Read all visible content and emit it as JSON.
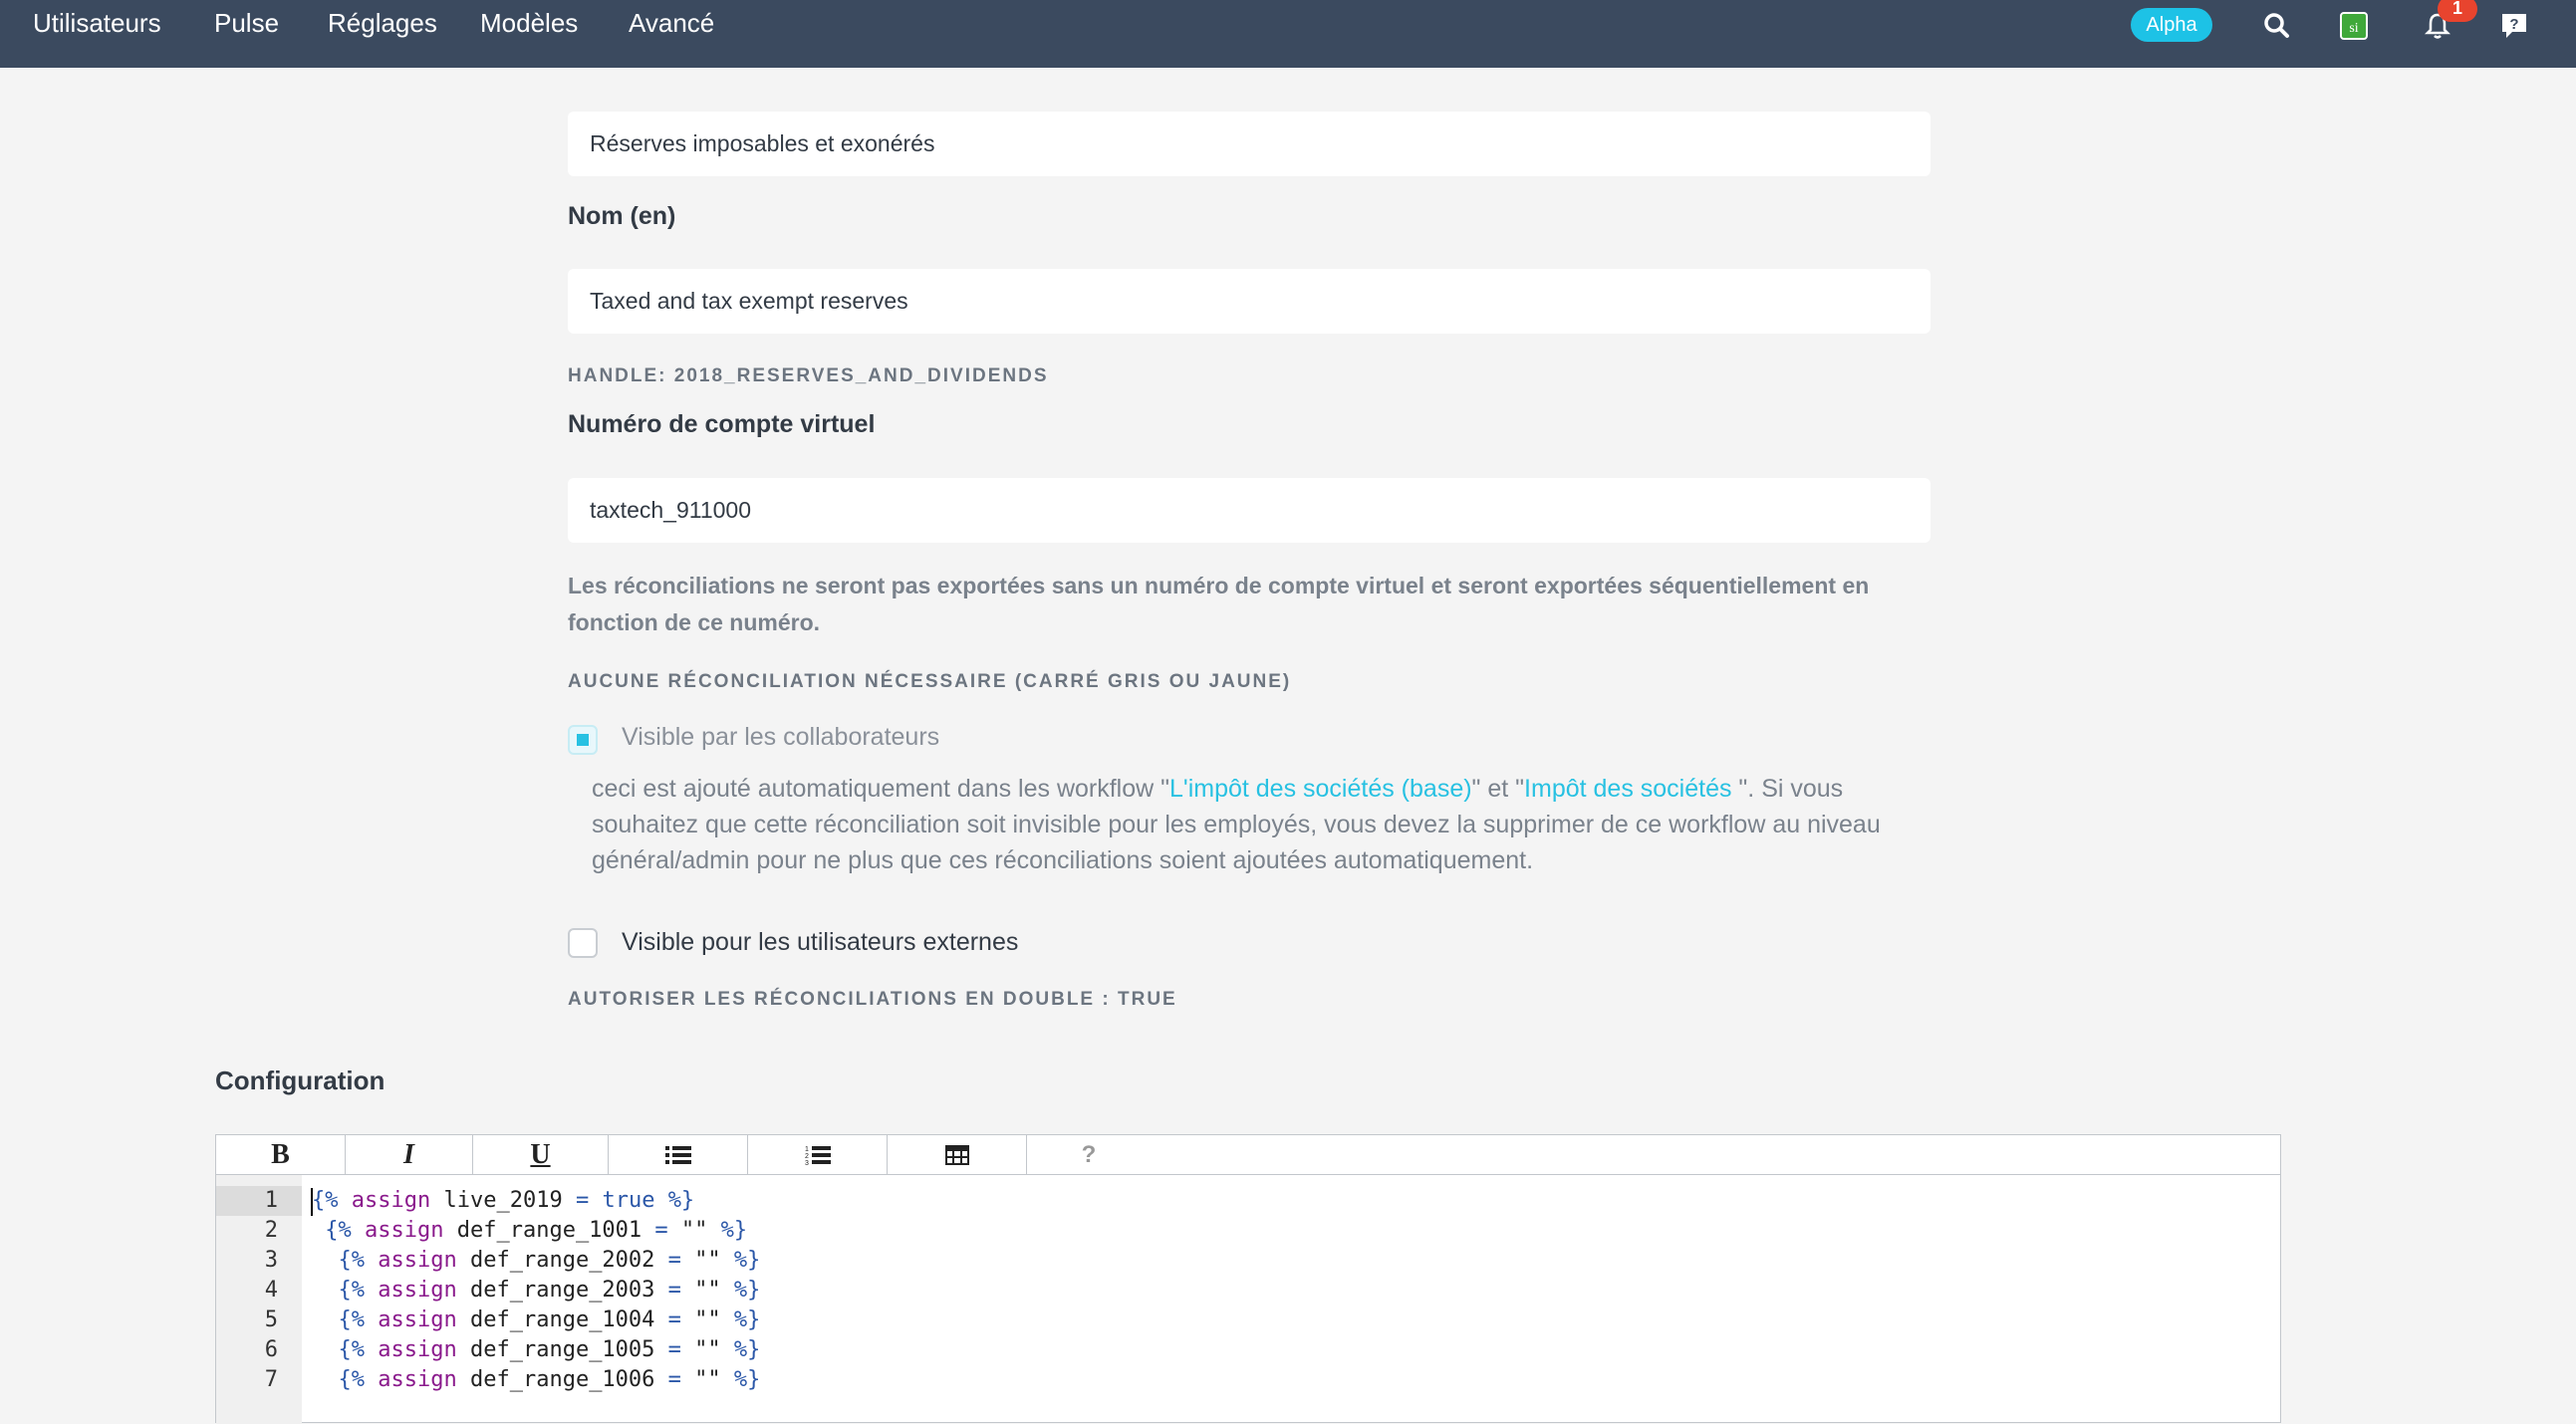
{
  "nav": {
    "items": [
      "Utilisateurs",
      "Pulse",
      "Réglages",
      "Modèles",
      "Avancé"
    ],
    "badge": "Alpha",
    "notifications_count": "1",
    "icons": [
      "search-icon",
      "silverfin-app-icon",
      "bell-icon",
      "help-chat-icon"
    ]
  },
  "form": {
    "name_fr_value": "Réserves imposables et exonérés",
    "name_en_label": "Nom (en)",
    "name_en_value": "Taxed and tax exempt reserves",
    "handle": "HANDLE: 2018_RESERVES_AND_DIVIDENDS",
    "account_label": "Numéro de compte virtuel",
    "account_value": "taxtech_911000",
    "account_help": "Les réconciliations ne seront pas exportées sans un numéro de compte virtuel et seront exportées séquentiellement en fonction de ce numéro.",
    "no_reconciliation": "AUCUNE RÉCONCILIATION NÉCESSAIRE (CARRÉ GRIS OU JAUNE)",
    "visible_collab_label": "Visible par les collaborateurs",
    "visible_collab_checked": true,
    "note_prefix": "ceci est ajouté automatiquement dans les workflow \"",
    "note_link1": "L'impôt des sociétés (base)",
    "note_mid": "\" et \"",
    "note_link2": "Impôt des sociétés",
    "note_suffix": " \". Si vous souhaitez que cette réconciliation soit invisible pour les employés, vous devez la supprimer de ce workflow au niveau général/admin pour ne plus que ces réconciliations soient ajoutées automatiquement.",
    "visible_external_label": "Visible pour les utilisateurs externes",
    "visible_external_checked": false,
    "allow_duplicates": "AUTORISER LES RÉCONCILIATIONS EN DOUBLE : TRUE"
  },
  "config": {
    "title": "Configuration",
    "toolbar": {
      "bold": "B",
      "italic": "I",
      "underline": "U",
      "help": "?",
      "icons": [
        "bullet-list-icon",
        "numbered-list-icon",
        "table-icon"
      ]
    },
    "lines": [
      {
        "num": "1",
        "indent": "",
        "var": "live_2019",
        "val": "true"
      },
      {
        "num": "2",
        "indent": " ",
        "var": "def_range_1001",
        "val": "\"\""
      },
      {
        "num": "3",
        "indent": "  ",
        "var": "def_range_2002",
        "val": "\"\""
      },
      {
        "num": "4",
        "indent": "  ",
        "var": "def_range_2003",
        "val": "\"\""
      },
      {
        "num": "5",
        "indent": "  ",
        "var": "def_range_1004",
        "val": "\"\""
      },
      {
        "num": "6",
        "indent": "  ",
        "var": "def_range_1005",
        "val": "\"\""
      },
      {
        "num": "7",
        "indent": "  ",
        "var": "def_range_1006",
        "val": "\"\""
      }
    ],
    "code_tokens": {
      "open": "{%",
      "close": "%}",
      "keyword": "assign",
      "equals": "="
    }
  }
}
